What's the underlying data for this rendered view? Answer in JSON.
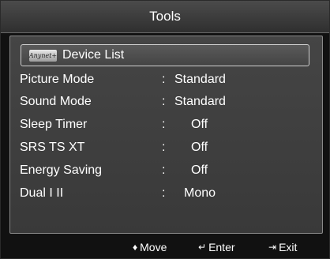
{
  "window": {
    "title": "Tools"
  },
  "device_list": {
    "logo_text": "Anynet+",
    "label": "Device List"
  },
  "menu": [
    {
      "label": "Picture Mode",
      "value": "Standard"
    },
    {
      "label": "Sound Mode",
      "value": "Standard"
    },
    {
      "label": "Sleep Timer",
      "value": "Off"
    },
    {
      "label": "SRS TS XT",
      "value": "Off"
    },
    {
      "label": "Energy Saving",
      "value": "Off"
    },
    {
      "label": "Dual I II",
      "value": "Mono"
    }
  ],
  "separator": ":",
  "footer": {
    "move_glyph": "♦",
    "move_label": "Move",
    "enter_glyph": "↵",
    "enter_label": "Enter",
    "exit_glyph": "⇥",
    "exit_label": "Exit"
  },
  "colors": {
    "background": "#111111",
    "panel": "#404040",
    "text": "#ffffff"
  }
}
